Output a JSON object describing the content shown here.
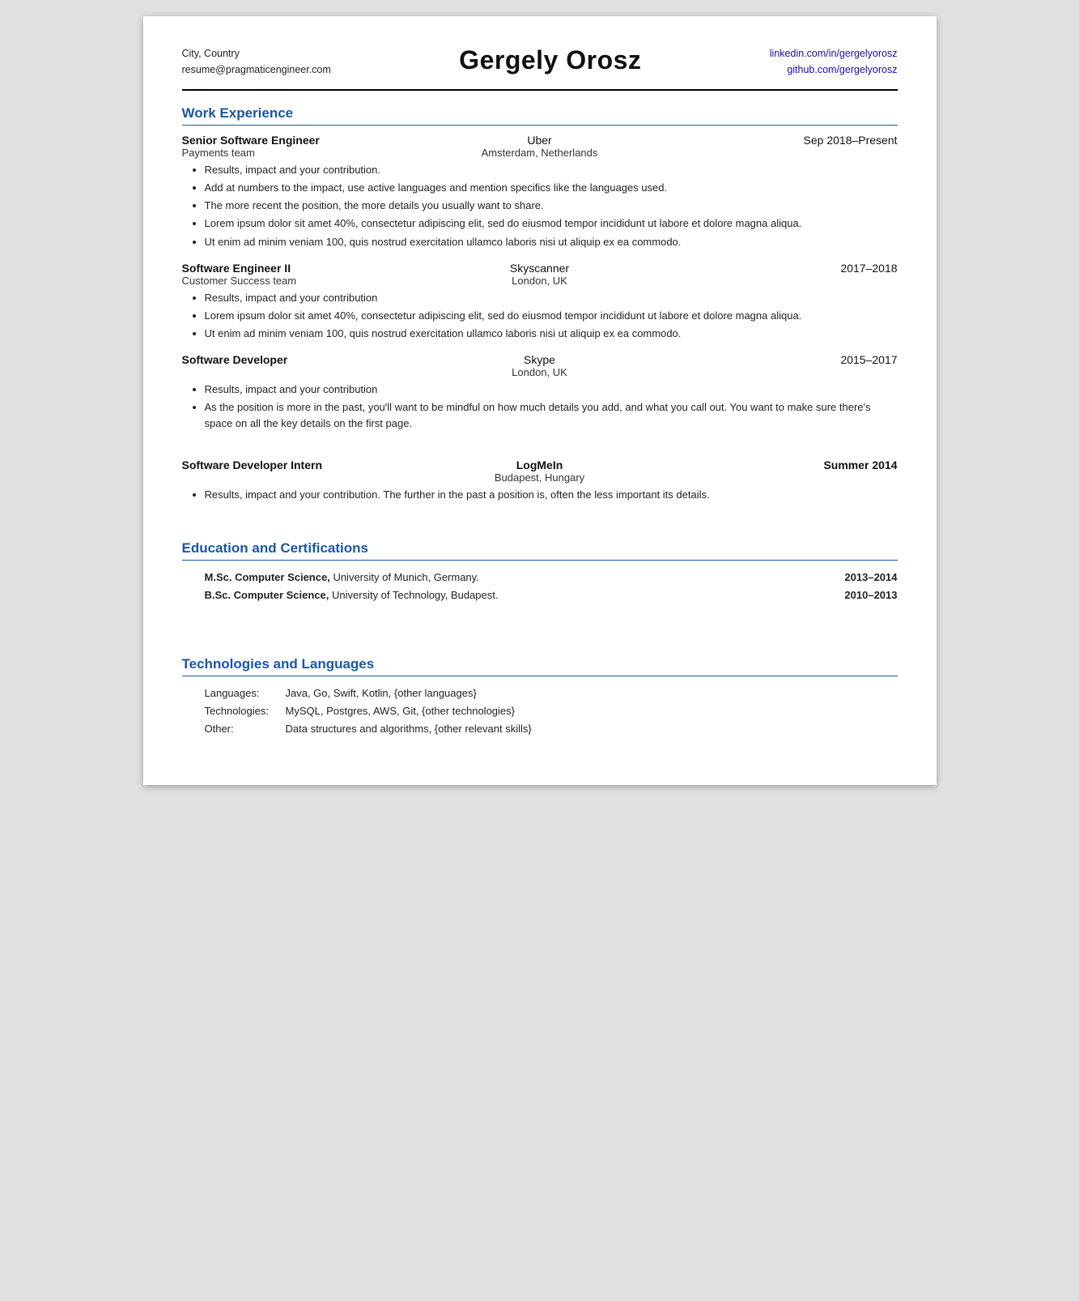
{
  "header": {
    "contact_line1": "City, Country",
    "contact_line2": "resume@pragmaticengineer.com",
    "name": "Gergely Orosz",
    "linkedin": "linkedin.com/in/gergelyorosz",
    "github": "github.com/gergelyorosz"
  },
  "sections": {
    "work_experience": {
      "title": "Work Experience",
      "jobs": [
        {
          "title": "Senior Software Engineer",
          "company": "Uber",
          "dates": "Sep 2018–Present",
          "team": "Payments team",
          "location": "Amsterdam, Netherlands",
          "bullets": [
            "Results, impact and your contribution.",
            "Add at numbers to the impact, use active languages and mention specifics like the languages used.",
            "The more recent the position, the more details you usually want to share.",
            "Lorem ipsum dolor sit amet 40%, consectetur adipiscing elit, sed do eiusmod tempor incididunt ut labore et dolore magna aliqua.",
            "Ut enim ad minim veniam 100, quis nostrud exercitation ullamco laboris nisi ut aliquip ex ea commodo."
          ]
        },
        {
          "title": "Software Engineer II",
          "company": "Skyscanner",
          "dates": "2017–2018",
          "team": "Customer Success team",
          "location": "London, UK",
          "bullets": [
            "Results, impact and your contribution",
            "Lorem ipsum dolor sit amet 40%, consectetur adipiscing elit, sed do eiusmod tempor incididunt ut labore et dolore magna aliqua.",
            "Ut enim ad minim veniam 100, quis nostrud exercitation ullamco laboris nisi ut aliquip ex ea commodo."
          ]
        },
        {
          "title": "Software Developer",
          "company": "Skype",
          "dates": "2015–2017",
          "team": "",
          "location": "London, UK",
          "bullets": [
            "Results, impact and your contribution",
            "As the position is more in the past, you'll want to be mindful on how much details you add, and what you call out. You want to make sure there's space on all the key details on the first page."
          ]
        },
        {
          "title": "Software Developer Intern",
          "company": "LogMeIn",
          "dates": "Summer 2014",
          "team": "",
          "location": "Budapest, Hungary",
          "bullets": [
            "Results, impact and your contribution. The further in the past a position is, often the less important its details."
          ]
        }
      ]
    },
    "education": {
      "title": "Education and Certifications",
      "items": [
        {
          "text": "M.Sc. Computer Science, University of Munich, Germany.",
          "bold_part": "M.Sc. Computer Science,",
          "year": "2013–2014"
        },
        {
          "text": "B.Sc. Computer Science, University of Technology, Budapest.",
          "bold_part": "B.Sc. Computer Science,",
          "year": "2010–2013"
        },
        {
          "text": "",
          "year": ""
        }
      ]
    },
    "technologies": {
      "title": "Technologies and Languages",
      "items": [
        {
          "label": "Languages:",
          "value": "Java, Go, Swift, Kotlin, {other languages}"
        },
        {
          "label": "Technologies:",
          "value": "MySQL, Postgres, AWS, Git, {other technologies}"
        },
        {
          "label": "Other:",
          "value": "Data structures and algorithms, {other relevant skills}"
        }
      ]
    }
  }
}
